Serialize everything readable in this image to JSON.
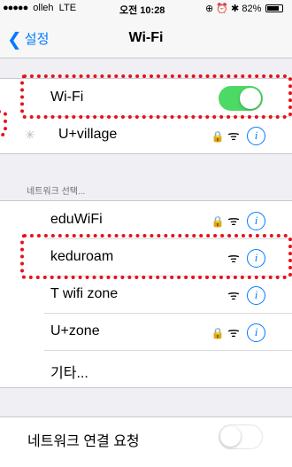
{
  "status_bar": {
    "carrier": "olleh",
    "network": "LTE",
    "time": "오전 10:28",
    "battery": "82%"
  },
  "nav": {
    "back_label": "설정",
    "title": "Wi-Fi"
  },
  "wifi": {
    "label": "Wi-Fi",
    "enabled": true
  },
  "connected_network": {
    "name": "U+village",
    "secured": true
  },
  "section_header": "네트워크 선택...",
  "networks": [
    {
      "name": "eduWiFi",
      "secured": true
    },
    {
      "name": "keduroam",
      "secured": false
    },
    {
      "name": "T wifi zone",
      "secured": false
    },
    {
      "name": "U+zone",
      "secured": true
    },
    {
      "name": "기타...",
      "secured": false
    }
  ],
  "ask_to_join": {
    "label": "네트워크 연결 요청",
    "enabled": false
  },
  "highlight_color": "#e8101b",
  "accent_color": "#007aff",
  "toggle_on_color": "#4cd964"
}
